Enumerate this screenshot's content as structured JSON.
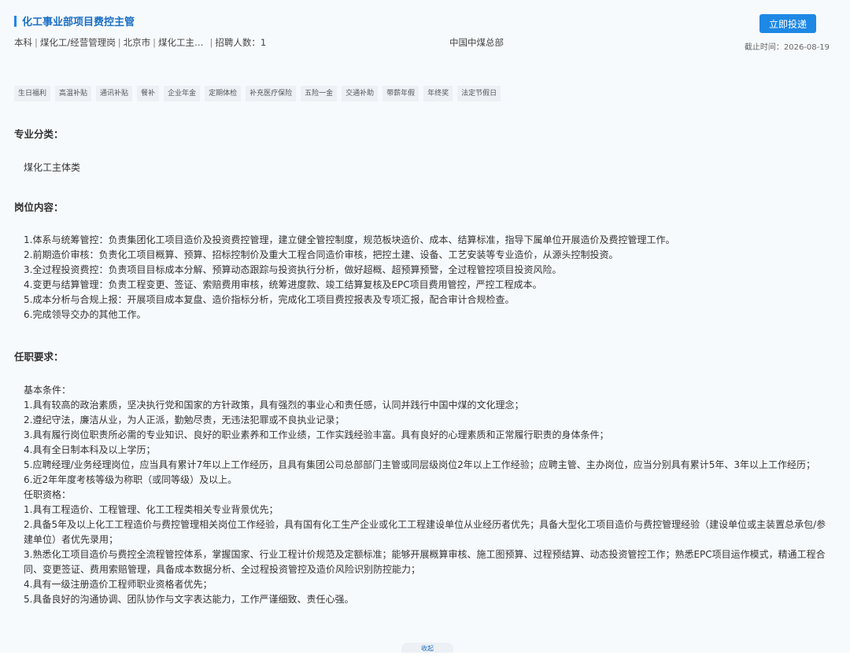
{
  "job": {
    "title": "化工事业部项目费控主管",
    "apply_label": "立即投递",
    "meta": [
      "本科",
      "煤化工/经营管理岗",
      "北京市",
      "煤化工主…"
    ],
    "recruit_count": "招聘人数：1",
    "company": "中国中煤总部",
    "deadline": "截止时间：2026-08-19"
  },
  "tags": [
    "生日福利",
    "高温补贴",
    "通讯补贴",
    "餐补",
    "企业年金",
    "定期体检",
    "补充医疗保险",
    "五险一金",
    "交通补助",
    "带薪年假",
    "年终奖",
    "法定节假日"
  ],
  "sections": {
    "category_title": "专业分类：",
    "category_value": "煤化工主体类",
    "content_title": "岗位内容：",
    "content_lines": [
      "1.体系与统筹管控：负责集团化工项目造价及投资费控管理，建立健全管控制度，规范板块造价、成本、结算标准，指导下属单位开展造价及费控管理工作。",
      "2.前期造价审核：负责化工项目概算、预算、招标控制价及重大工程合同造价审核，把控土建、设备、工艺安装等专业造价，从源头控制投资。",
      "3.全过程投资费控：负责项目目标成本分解、预算动态跟踪与投资执行分析，做好超概、超预算预警，全过程管控项目投资风险。",
      "4.变更与结算管理：负责工程变更、签证、索赔费用审核，统筹进度款、竣工结算复核及EPC项目费用管控，严控工程成本。",
      "5.成本分析与合规上报：开展项目成本复盘、造价指标分析，完成化工项目费控报表及专项汇报，配合审计合规检查。",
      "6.完成领导交办的其他工作。"
    ],
    "req_title": "任职要求：",
    "req_lines": [
      "基本条件：",
      "1.具有较高的政治素质，坚决执行党和国家的方针政策，具有强烈的事业心和责任感，认同并践行中国中煤的文化理念；",
      "2.遵纪守法，廉洁从业，为人正派，勤勉尽责，无违法犯罪或不良执业记录；",
      "3.具有履行岗位职责所必需的专业知识、良好的职业素养和工作业绩，工作实践经验丰富。具有良好的心理素质和正常履行职责的身体条件；",
      "4.具有全日制本科及以上学历；",
      "5.应聘经理/业务经理岗位，应当具有累计7年以上工作经历，且具有集团公司总部部门主管或同层级岗位2年以上工作经验；应聘主管、主办岗位，应当分别具有累计5年、3年以上工作经历；",
      "6.近2年年度考核等级为称职（或同等级）及以上。",
      "任职资格：",
      "1.具有工程造价、工程管理、化工工程类相关专业背景优先；",
      "2.具备5年及以上化工工程造价与费控管理相关岗位工作经验，具有国有化工生产企业或化工工程建设单位从业经历者优先；具备大型化工项目造价与费控管理经验（建设单位或主装置总承包/参建单位）者优先录用；",
      "3.熟悉化工项目造价与费控全流程管控体系，掌握国家、行业工程计价规范及定额标准；能够开展概算审核、施工图预算、过程预结算、动态投资管控工作；熟悉EPC项目运作模式，精通工程合同、变更签证、费用索赔管理，具备成本数据分析、全过程投资管控及造价风险识别防控能力；",
      "4.具有一级注册造价工程师职业资格者优先；",
      "5.具备良好的沟通协调、团队协作与文字表达能力，工作严谨细致、责任心强。"
    ]
  },
  "collapse_label": "收起",
  "colors": {
    "accent": "#1e88e5",
    "title": "#1a6fc4",
    "background": "#f7fafd",
    "tag_bg": "#edf1f6"
  }
}
